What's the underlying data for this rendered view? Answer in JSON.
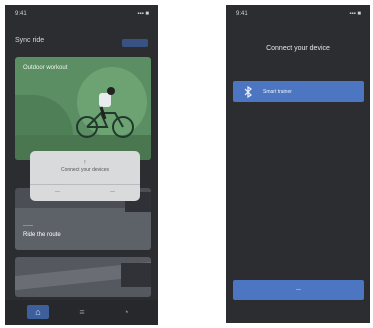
{
  "left_screen": {
    "status": {
      "time": "9:41",
      "signal": "▪▪▪ ■"
    },
    "header": {
      "title": "Sync ride"
    },
    "featured": {
      "title": "Outdoor workout"
    },
    "dialog": {
      "line1": "!",
      "line2": "Connect your devices",
      "cancel": "—",
      "ok": "—"
    },
    "mid_card": {
      "subtitle": "——",
      "caption": "Ride the route"
    },
    "tabs": [
      {
        "icon": "home-icon",
        "glyph": "⌂"
      },
      {
        "icon": "list-icon",
        "glyph": "≡"
      },
      {
        "icon": "profile-icon",
        "glyph": "◔"
      }
    ]
  },
  "right_screen": {
    "status": {
      "time": "9:41",
      "signal": "▪▪▪ ■"
    },
    "title": "Connect your device",
    "device": {
      "icon": "bluetooth-icon",
      "label": "Smart trainer"
    },
    "bottom_button": "—"
  },
  "colors": {
    "background": "#2b2d31",
    "accent": "#4c76c2",
    "card_green": "#5b8e63"
  }
}
